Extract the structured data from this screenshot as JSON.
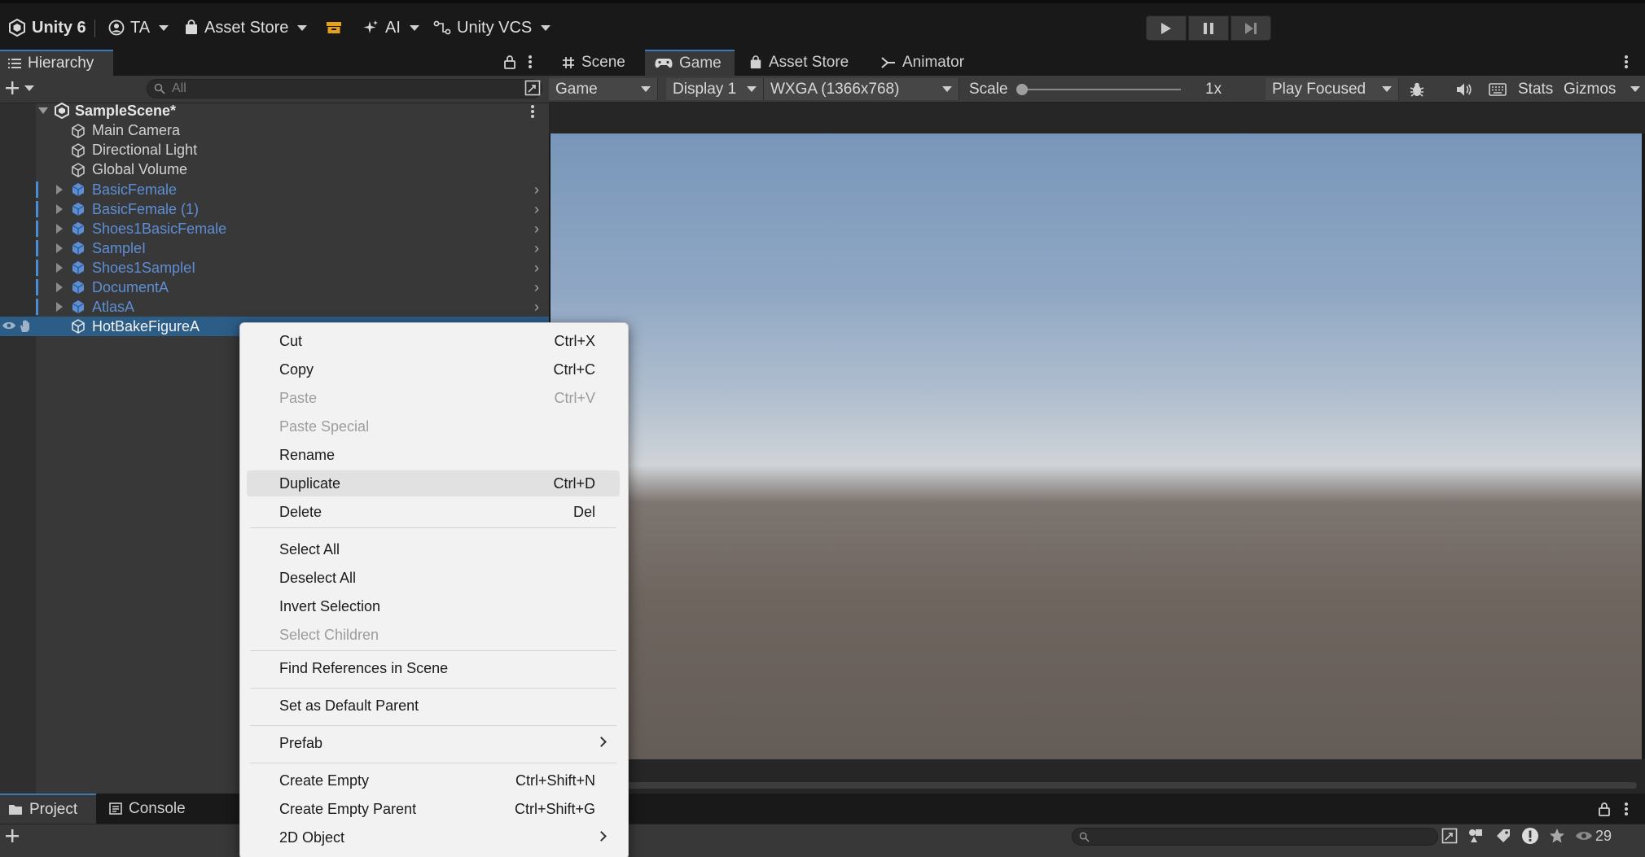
{
  "toolbar": {
    "unity_label": "Unity 6",
    "account_label": "TA",
    "asset_store_label": "Asset Store",
    "ai_label": "AI",
    "vcs_label": "Unity VCS"
  },
  "hierarchy": {
    "tab_label": "Hierarchy",
    "search_placeholder": "All",
    "scene_name": "SampleScene*",
    "items": [
      {
        "label": "Main Camera"
      },
      {
        "label": "Directional Light"
      },
      {
        "label": "Global Volume"
      },
      {
        "label": "BasicFemale"
      },
      {
        "label": "BasicFemale (1)"
      },
      {
        "label": "Shoes1BasicFemale"
      },
      {
        "label": "SampleI"
      },
      {
        "label": "Shoes1SampleI"
      },
      {
        "label": "DocumentA"
      },
      {
        "label": "AtlasA"
      },
      {
        "label": "HotBakeFigureA"
      }
    ]
  },
  "game_tabs": {
    "scene": "Scene",
    "game": "Game",
    "asset_store": "Asset Store",
    "animator": "Animator"
  },
  "game_toolbar": {
    "mode": "Game",
    "display": "Display 1",
    "resolution": "WXGA (1366x768)",
    "scale_label": "Scale",
    "scale_value": "1x",
    "play_mode": "Play Focused",
    "stats": "Stats",
    "gizmos": "Gizmos"
  },
  "project": {
    "tab_project": "Project",
    "tab_console": "Console",
    "visibility_count": "29"
  },
  "context_menu": {
    "items": [
      {
        "label": "Cut",
        "shortcut": "Ctrl+X"
      },
      {
        "label": "Copy",
        "shortcut": "Ctrl+C"
      },
      {
        "label": "Paste",
        "shortcut": "Ctrl+V"
      },
      {
        "label": "Paste Special",
        "shortcut": ""
      },
      {
        "label": "Rename",
        "shortcut": ""
      },
      {
        "label": "Duplicate",
        "shortcut": "Ctrl+D"
      },
      {
        "label": "Delete",
        "shortcut": "Del"
      },
      {
        "label": "Select All",
        "shortcut": ""
      },
      {
        "label": "Deselect All",
        "shortcut": ""
      },
      {
        "label": "Invert Selection",
        "shortcut": ""
      },
      {
        "label": "Select Children",
        "shortcut": ""
      },
      {
        "label": "Find References in Scene",
        "shortcut": ""
      },
      {
        "label": "Set as Default Parent",
        "shortcut": ""
      },
      {
        "label": "Prefab",
        "shortcut": ""
      },
      {
        "label": "Create Empty",
        "shortcut": "Ctrl+Shift+N"
      },
      {
        "label": "Create Empty Parent",
        "shortcut": "Ctrl+Shift+G"
      },
      {
        "label": "2D Object",
        "shortcut": ""
      }
    ]
  },
  "colors": {
    "accent": "#3a79bb",
    "prefab_blue": "#5d8ed4",
    "selection": "#2c5d87",
    "menu_bg": "#f2f2f2"
  }
}
